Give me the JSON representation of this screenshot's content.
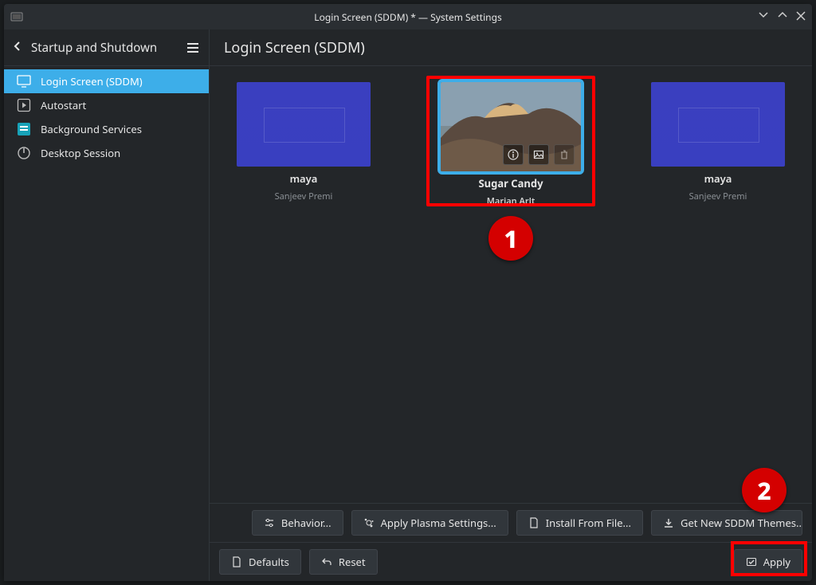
{
  "titlebar": {
    "title": "Login Screen (SDDM) * — System Settings"
  },
  "sidebar": {
    "back_label": "Startup and Shutdown",
    "items": [
      {
        "label": "Login Screen (SDDM)",
        "icon": "login"
      },
      {
        "label": "Autostart",
        "icon": "play"
      },
      {
        "label": "Background Services",
        "icon": "services"
      },
      {
        "label": "Desktop Session",
        "icon": "session"
      }
    ]
  },
  "main": {
    "title": "Login Screen (SDDM)",
    "themes": [
      {
        "name": "maya",
        "author": "Sanjeev Premi"
      },
      {
        "name": "Sugar Candy",
        "author": "Marian Arlt"
      },
      {
        "name": "maya",
        "author": "Sanjeev Premi"
      }
    ]
  },
  "footer1": {
    "behavior": "Behavior...",
    "apply_plasma": "Apply Plasma Settings...",
    "install_file": "Install From File...",
    "get_new": "Get New SDDM Themes..."
  },
  "footer2": {
    "defaults": "Defaults",
    "reset": "Reset",
    "apply": "Apply"
  },
  "annotations": {
    "badge1": "1",
    "badge2": "2"
  }
}
